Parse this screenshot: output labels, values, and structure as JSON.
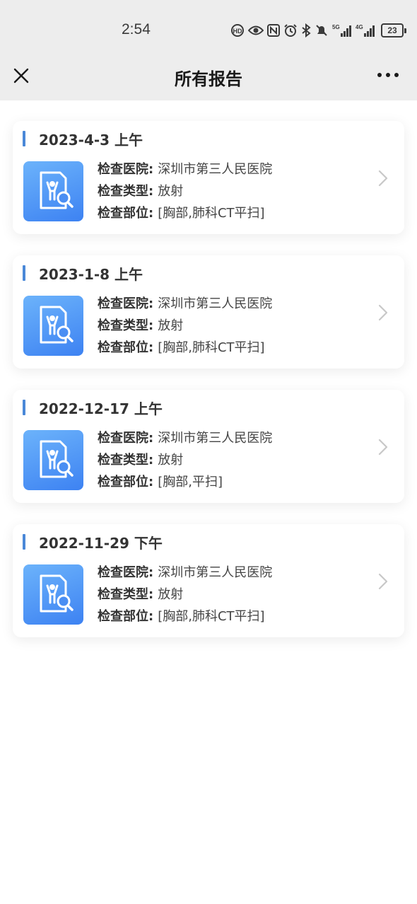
{
  "status_bar": {
    "time": "2:54",
    "battery": "23",
    "icons": [
      "hd-call-icon",
      "eye-icon",
      "nfc-icon",
      "alarm-icon",
      "bluetooth-icon",
      "mute-icon",
      "5g-signal-icon",
      "4g-signal-icon",
      "battery-icon"
    ]
  },
  "header": {
    "title": "所有报告",
    "close_icon": "close-icon",
    "more_icon": "more-icon"
  },
  "labels": {
    "hospital": "检查医院:",
    "type": "检查类型:",
    "site": "检查部位:"
  },
  "reports": [
    {
      "date": "2023-4-3 上午",
      "hospital": "深圳市第三人民医院",
      "type": "放射",
      "site": "[胸部,肺科CT平扫]"
    },
    {
      "date": "2023-1-8 上午",
      "hospital": "深圳市第三人民医院",
      "type": "放射",
      "site": "[胸部,肺科CT平扫]"
    },
    {
      "date": "2022-12-17 上午",
      "hospital": "深圳市第三人民医院",
      "type": "放射",
      "site": "[胸部,平扫]"
    },
    {
      "date": "2022-11-29 下午",
      "hospital": "深圳市第三人民医院",
      "type": "放射",
      "site": "[胸部,肺科CT平扫]"
    }
  ],
  "colors": {
    "accent": "#4a88d8",
    "icon_gradient_top": "#6cb3fb",
    "icon_gradient_bottom": "#3d82f2",
    "header_bg": "#ededed"
  }
}
